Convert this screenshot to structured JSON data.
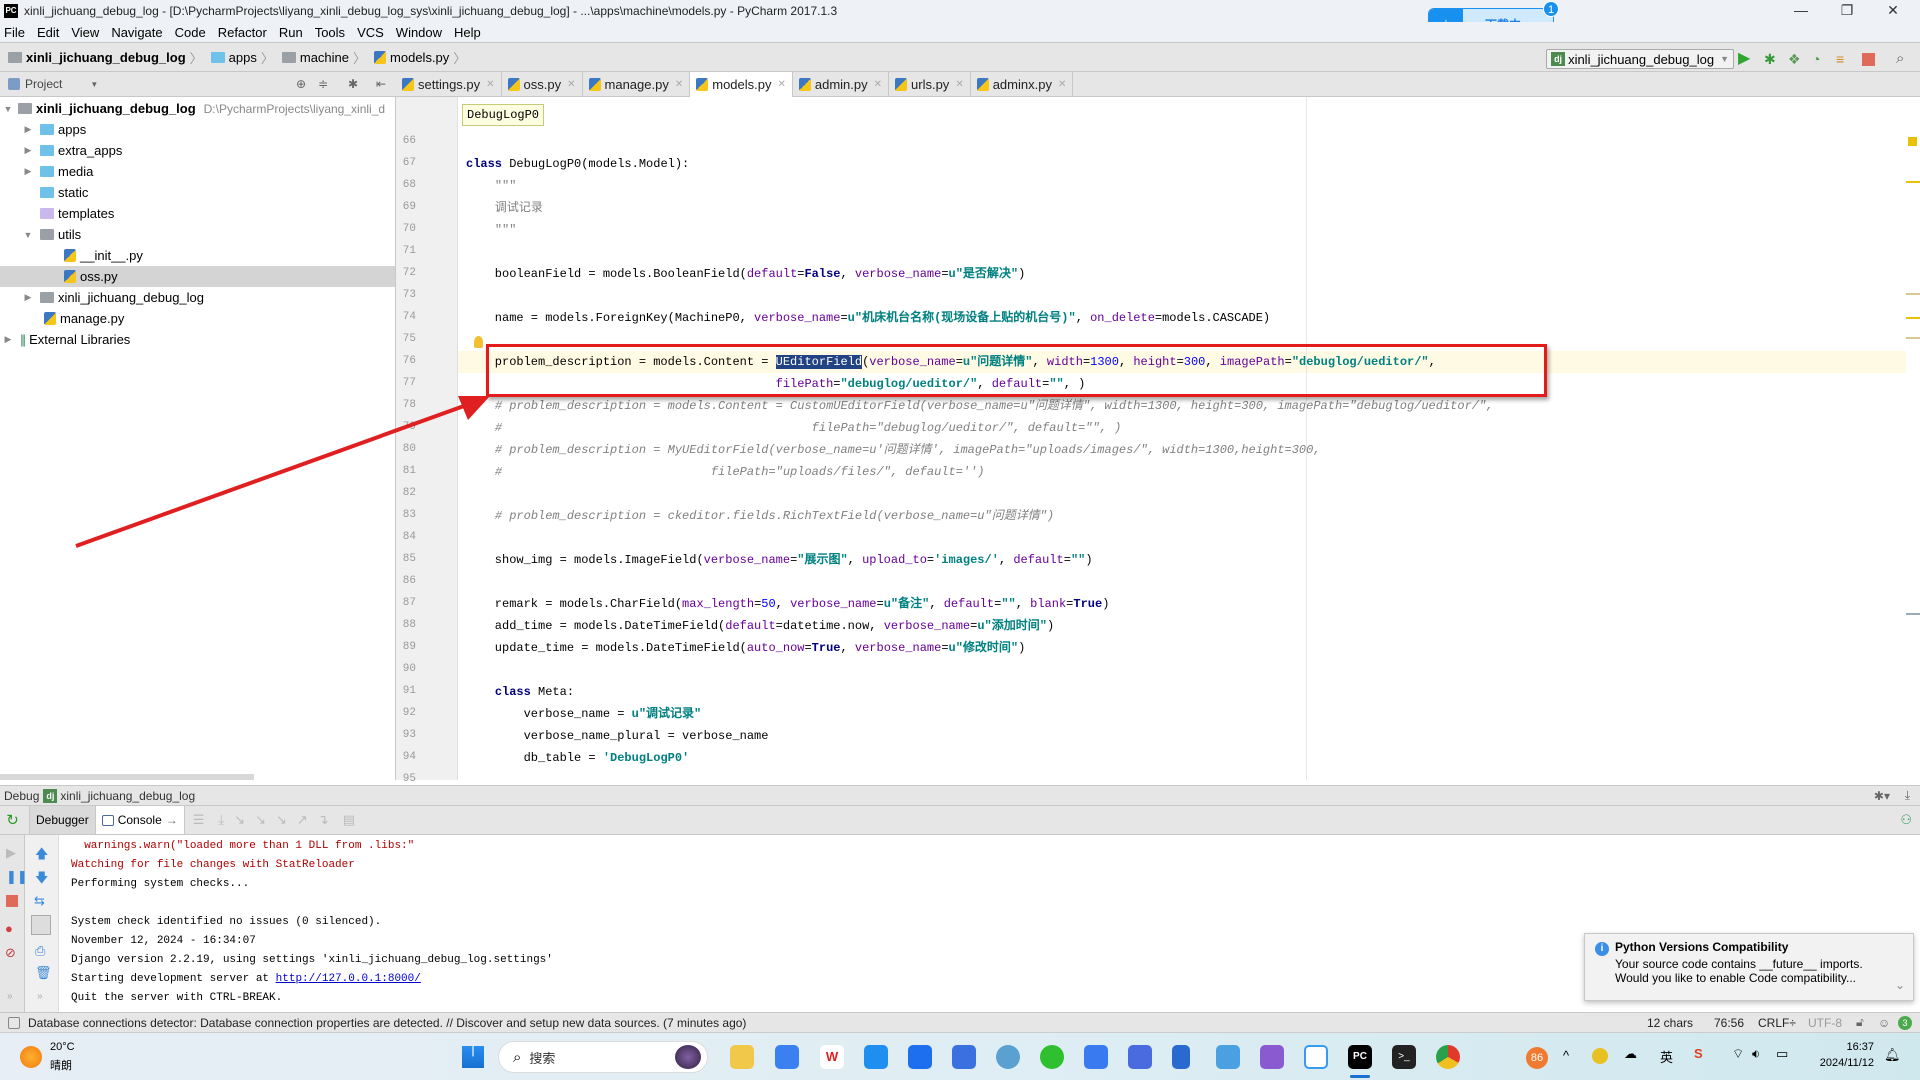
{
  "window": {
    "title": "xinli_jichuang_debug_log - [D:\\PycharmProjects\\liyang_xinli_debug_log_sys\\xinli_jichuang_debug_log] - ...\\apps\\machine\\models.py - PyCharm 2017.1.3",
    "app_icon": "PC"
  },
  "download_popup": {
    "label": "下载中...",
    "badge": "1"
  },
  "menu": [
    "File",
    "Edit",
    "View",
    "Navigate",
    "Code",
    "Refactor",
    "Run",
    "Tools",
    "VCS",
    "Window",
    "Help"
  ],
  "breadcrumb": [
    "xinli_jichuang_debug_log",
    "apps",
    "machine",
    "models.py"
  ],
  "run_config": {
    "label": "xinli_jichuang_debug_log",
    "icon": "dj"
  },
  "project_panel": {
    "title": "Project",
    "root": {
      "name": "xinli_jichuang_debug_log",
      "path": "D:\\PycharmProjects\\liyang_xinli_d"
    },
    "items": [
      {
        "label": "apps",
        "type": "folder",
        "depth": 1,
        "expanded": false
      },
      {
        "label": "extra_apps",
        "type": "folder",
        "depth": 1,
        "expanded": false
      },
      {
        "label": "media",
        "type": "folder",
        "depth": 1,
        "expanded": false
      },
      {
        "label": "static",
        "type": "folder",
        "depth": 1,
        "expanded": null
      },
      {
        "label": "templates",
        "type": "folder-template",
        "depth": 1,
        "expanded": null
      },
      {
        "label": "utils",
        "type": "package",
        "depth": 1,
        "expanded": true
      },
      {
        "label": "__init__.py",
        "type": "python",
        "depth": 2
      },
      {
        "label": "oss.py",
        "type": "python",
        "depth": 2,
        "selected": true
      },
      {
        "label": "xinli_jichuang_debug_log",
        "type": "package",
        "depth": 1,
        "expanded": false
      },
      {
        "label": "manage.py",
        "type": "python",
        "depth": 1
      },
      {
        "label": "External Libraries",
        "type": "library",
        "depth": 0,
        "expanded": false
      }
    ]
  },
  "editor_tabs": [
    {
      "label": "settings.py",
      "active": false
    },
    {
      "label": "oss.py",
      "active": false
    },
    {
      "label": "manage.py",
      "active": false
    },
    {
      "label": "models.py",
      "active": true
    },
    {
      "label": "admin.py",
      "active": false
    },
    {
      "label": "urls.py",
      "active": false
    },
    {
      "label": "adminx.py",
      "active": false
    }
  ],
  "editor": {
    "breadcrumb_tip": "DebugLogP0",
    "lines": [
      {
        "n": "66",
        "html": ""
      },
      {
        "n": "67",
        "html": "<span class='kw'>class</span> DebugLogP0(models.Model):"
      },
      {
        "n": "68",
        "html": "    <span class='doc'>\"\"\"</span>"
      },
      {
        "n": "69",
        "html": "    <span class='doc'>调试记录</span>"
      },
      {
        "n": "70",
        "html": "    <span class='doc'>\"\"\"</span>"
      },
      {
        "n": "71",
        "html": ""
      },
      {
        "n": "72",
        "html": "    booleanField = models.BooleanField(<span class='arg'>default</span>=<span class='kw'>False</span>, <span class='arg'>verbose_name</span>=<span class='str'>u\"是否解决\"</span>)"
      },
      {
        "n": "73",
        "html": ""
      },
      {
        "n": "74",
        "html": "    name = models.ForeignKey(MachineP0, <span class='arg'>verbose_name</span>=<span class='str'>u\"机床机台名称(现场设备上贴的机台号)\"</span>, <span class='arg'>on_delete</span>=models.CASCADE)"
      },
      {
        "n": "75",
        "html": ""
      },
      {
        "n": "76",
        "html": "    problem_description = models.Content = <span class='hl'>UEditorField</span>(<span class='arg'>verbose_name</span>=<span class='str'>u\"问题详情\"</span>, <span class='arg'>width</span>=<span class='num'>1300</span>, <span class='arg'>height</span>=<span class='num'>300</span>, <span class='arg'>imagePath</span>=<span class='str'>\"debuglog/ueditor/\"</span>,"
      },
      {
        "n": "77",
        "html": "                                           <span class='arg'>filePath</span>=<span class='str'>\"debuglog/ueditor/\"</span>, <span class='arg'>default</span>=<span class='str'>\"\"</span>, )"
      },
      {
        "n": "78",
        "html": "    <span class='cmt'># problem_description = models.Content = CustomUEditorField(verbose_name=u\"问题详情\", width=1300, height=300, imagePath=\"debuglog/ueditor/\",</span>"
      },
      {
        "n": "79",
        "html": "    <span class='cmt'>#                                           filePath=\"debuglog/ueditor/\", default=\"\", )</span>"
      },
      {
        "n": "80",
        "html": "    <span class='cmt'># problem_description = MyUEditorField(verbose_name=u'问题详情', imagePath=\"uploads/images/\", width=1300,height=300,</span>"
      },
      {
        "n": "81",
        "html": "    <span class='cmt'>#                             filePath=\"uploads/files/\", default='')</span>"
      },
      {
        "n": "82",
        "html": ""
      },
      {
        "n": "83",
        "html": "    <span class='cmt'># problem_description = ckeditor.fields.RichTextField(verbose_name=u\"问题详情\")</span>"
      },
      {
        "n": "84",
        "html": ""
      },
      {
        "n": "85",
        "html": "    show_img = models.ImageField(<span class='arg'>verbose_name</span>=<span class='str'>\"展示图\"</span>, <span class='arg'>upload_to</span>=<span class='str'>'images/'</span>, <span class='arg'>default</span>=<span class='str'>\"\"</span>)"
      },
      {
        "n": "86",
        "html": ""
      },
      {
        "n": "87",
        "html": "    remark = models.CharField(<span class='arg'>max_length</span>=<span class='num'>50</span>, <span class='arg'>verbose_name</span>=<span class='str'>u\"备注\"</span>, <span class='arg'>default</span>=<span class='str'>\"\"</span>, <span class='arg'>blank</span>=<span class='kw'>True</span>)"
      },
      {
        "n": "88",
        "html": "    add_time = models.DateTimeField(<span class='arg'>default</span>=datetime.now, <span class='arg'>verbose_name</span>=<span class='str'>u\"添加时间\"</span>)"
      },
      {
        "n": "89",
        "html": "    update_time = models.DateTimeField(<span class='arg'>auto_now</span>=<span class='kw'>True</span>, <span class='arg'>verbose_name</span>=<span class='str'>u\"修改时间\"</span>)"
      },
      {
        "n": "90",
        "html": ""
      },
      {
        "n": "91",
        "html": "    <span class='kw'>class</span> Meta:"
      },
      {
        "n": "92",
        "html": "        verbose_name = <span class='str'>u\"调试记录\"</span>"
      },
      {
        "n": "93",
        "html": "        verbose_name_plural = verbose_name"
      },
      {
        "n": "94",
        "html": "        db_table = <span class='str'>'DebugLogP0'</span>"
      },
      {
        "n": "95",
        "html": ""
      }
    ]
  },
  "debug_panel": {
    "title": "Debug",
    "config": "xinli_jichuang_debug_log",
    "tabs": [
      "Debugger",
      "Console"
    ],
    "console_lines": [
      {
        "text": "  warnings.warn(\"loaded more than 1 DLL from .libs:\"",
        "type": "error"
      },
      {
        "text": "Watching for file changes with StatReloader",
        "type": "error"
      },
      {
        "text": "Performing system checks...",
        "type": "normal"
      },
      {
        "text": "",
        "type": "normal"
      },
      {
        "text": "System check identified no issues (0 silenced).",
        "type": "normal"
      },
      {
        "text": "November 12, 2024 - 16:34:07",
        "type": "normal"
      },
      {
        "text": "Django version 2.2.19, using settings 'xinli_jichuang_debug_log.settings'",
        "type": "normal"
      },
      {
        "text": "Starting development server at ",
        "type": "normal",
        "link": "http://127.0.0.1:8000/"
      },
      {
        "text": "Quit the server with CTRL-BREAK.",
        "type": "normal"
      }
    ]
  },
  "notification": {
    "title": "Python Versions Compatibility",
    "line1": "Your source code contains __future__ imports.",
    "line2": "Would you like to enable Code compatibility..."
  },
  "status_bar": {
    "message": "Database connections detector: Database connection properties are detected. // Discover and setup new data sources. (7 minutes ago)",
    "selection": "12 chars",
    "position": "76:56",
    "line_sep": "CRLF÷",
    "encoding": "UTF-8",
    "events_badge": "3"
  },
  "taskbar": {
    "weather_temp": "20°C",
    "weather_desc": "晴朗",
    "search_placeholder": "搜索",
    "tray_badge": "86",
    "ime": "英",
    "time": "16:37",
    "date": "2024/11/12"
  }
}
